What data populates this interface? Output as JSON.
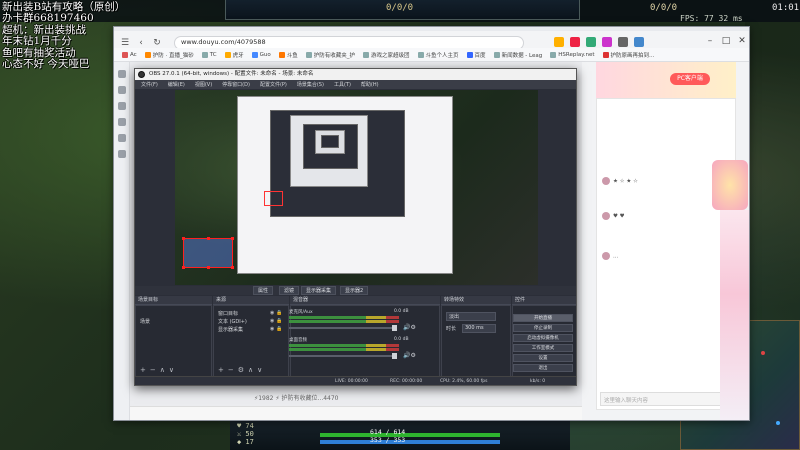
{
  "game": {
    "score": "0/0/0",
    "kda": "0/0/0",
    "fps": "FPS:  77    32 ms",
    "time": "01:01",
    "overlay_lines": [
      "新出装B站有攻略（原创）",
      "办卡群668197460",
      "超机：新出装挑战",
      "年末钻1月千分",
      "鱼吧有抽奖活动",
      "心态不好 今天哑巴"
    ],
    "stats": [
      "♥ 74",
      "⚔ 50",
      "◆ 17",
      "✚ 0"
    ],
    "hp_text": "614 / 614",
    "mp_text": "353 / 353"
  },
  "browser": {
    "url": "www.douyu.com/4079588",
    "url_prefix": "ⓘ 斗鱼直播 | 🔒 https://",
    "bookmarks": [
      "Ac",
      "护防 · 直播_猫砂",
      "TC",
      "虎牙",
      "Guo",
      "斗鱼",
      "护防有收藏夹_护",
      "游戏之家超级团",
      "斗鱼个人主页",
      "百度",
      "新闻数据 - Leag",
      "HSReplay.net",
      "护防原画再拍到…",
      "[护]"
    ],
    "footer": "⚡1982  ⚡  护防有收藏位...4470",
    "pc_button": "PC客户端",
    "chat_input": "这里输入聊天内容"
  },
  "obs": {
    "title": "OBS 27.0.1 (64-bit, windows) - 配置文件: 未命名 - 场景: 未命名",
    "menu": [
      "文件(F)",
      "编辑(E)",
      "视图(V)",
      "停靠窗口(D)",
      "配置文件(P)",
      "场景集合(S)",
      "工具(T)",
      "帮助(H)"
    ],
    "tabs": [
      "属性",
      "滤镜",
      "显示器采集",
      "显示器2"
    ],
    "headers": {
      "scenes": "场景目标",
      "sources": "来源",
      "mixer": "混音器",
      "transitions": "转场特效",
      "controls": "控件"
    },
    "scene_items": [
      "场景"
    ],
    "sources": [
      "窗口目标",
      "文本 (GDI+)",
      "显示器采集"
    ],
    "mixer": [
      {
        "name": "麦克风/Aux",
        "db": "0.0 dB"
      },
      {
        "name": "桌面音频",
        "db": "0.0 dB"
      }
    ],
    "transition": {
      "type": "淡出",
      "duration_label": "时长",
      "duration": "300 ms"
    },
    "controls": [
      "开始直播",
      "停止录制",
      "启动虚拟摄像机",
      "工作室模式",
      "设置",
      "退出"
    ],
    "status": {
      "live": "LIVE: 00:00:00",
      "rec": "REC: 00:00:00",
      "cpu": "CPU: 2.4%, 60.00 fps",
      "kb": "kb/s: 0"
    }
  },
  "colors": {
    "obs_bg": "#2b2e38",
    "selection_red": "#ff2020",
    "douyu_orange": "#ff5a5a"
  }
}
